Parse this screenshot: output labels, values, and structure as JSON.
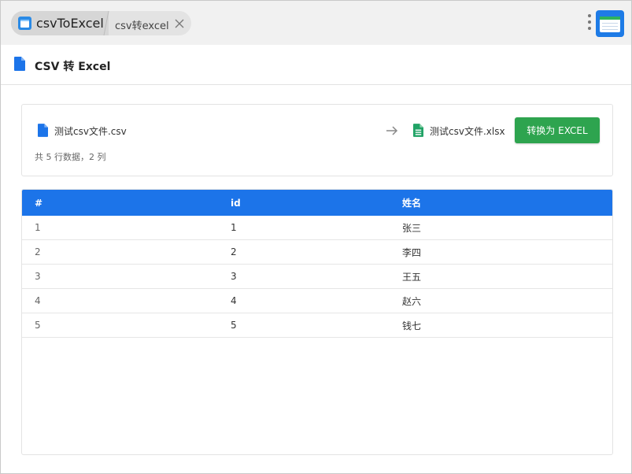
{
  "window": {
    "app_name": "csvToExcel",
    "tab_title": "csv转excel"
  },
  "header": {
    "title": "CSV 转 Excel"
  },
  "conversion": {
    "source_file": "测试csv文件.csv",
    "target_file": "测试csv文件.xlsx",
    "summary": "共 5 行数据，2 列",
    "convert_label": "转换为 EXCEL"
  },
  "table": {
    "columns": [
      "#",
      "id",
      "姓名"
    ],
    "rows": [
      [
        "1",
        "1",
        "张三"
      ],
      [
        "2",
        "2",
        "李四"
      ],
      [
        "3",
        "3",
        "王五"
      ],
      [
        "4",
        "4",
        "赵六"
      ],
      [
        "5",
        "5",
        "钱七"
      ]
    ]
  },
  "colors": {
    "accent_blue": "#1c74e9",
    "convert_green": "#2ea44f",
    "excel_green": "#21a366"
  },
  "icons": [
    "app-icon",
    "close-icon",
    "more-vert-icon",
    "extension-icon",
    "document-icon",
    "arrow-right-icon",
    "spreadsheet-icon"
  ]
}
